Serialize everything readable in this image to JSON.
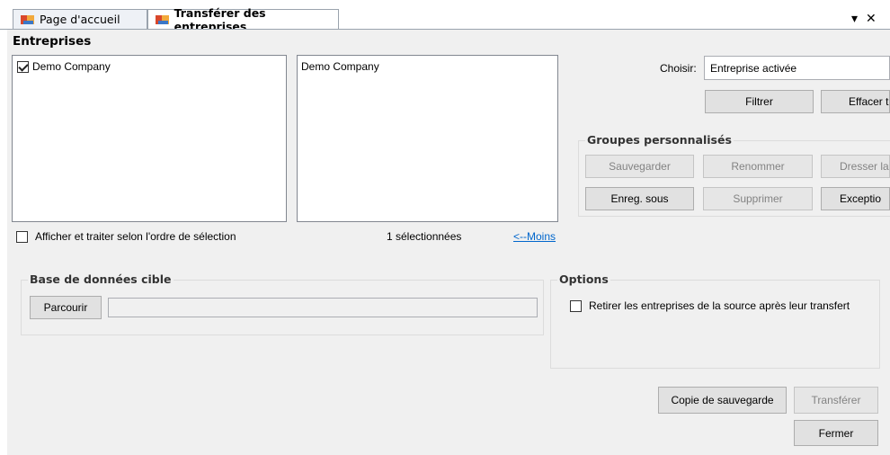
{
  "tabs": [
    {
      "label": "Page d'accueil",
      "active": false
    },
    {
      "label": "Transférer des entreprises",
      "active": true
    }
  ],
  "window_controls": {
    "dropdown": "▾",
    "close": "✕"
  },
  "entreprises": {
    "header": "Entreprises",
    "available": [
      {
        "label": "Demo Company",
        "checked": true
      }
    ],
    "selected": [
      "Demo Company"
    ],
    "order_checkbox_label": "Afficher et traiter selon l'ordre de sélection",
    "selected_count": "1 sélectionnées",
    "less_link": "<--Moins"
  },
  "filter": {
    "choose_label": "Choisir:",
    "choose_value": "Entreprise activée",
    "filter_button": "Filtrer",
    "clear_button": "Effacer t"
  },
  "custom_groups": {
    "title": "Groupes personnalisés",
    "save": "Sauvegarder",
    "rename": "Renommer",
    "list": "Dresser la",
    "save_as": "Enreg. sous",
    "delete": "Supprimer",
    "exceptions": "Exceptio"
  },
  "target_db": {
    "title": "Base de données cible",
    "browse": "Parcourir",
    "path": ""
  },
  "options": {
    "title": "Options",
    "remove_label": "Retirer les entreprises de la source après leur transfert",
    "remove_checked": false
  },
  "actions": {
    "backup": "Copie de sauvegarde",
    "transfer": "Transférer",
    "close": "Fermer"
  }
}
